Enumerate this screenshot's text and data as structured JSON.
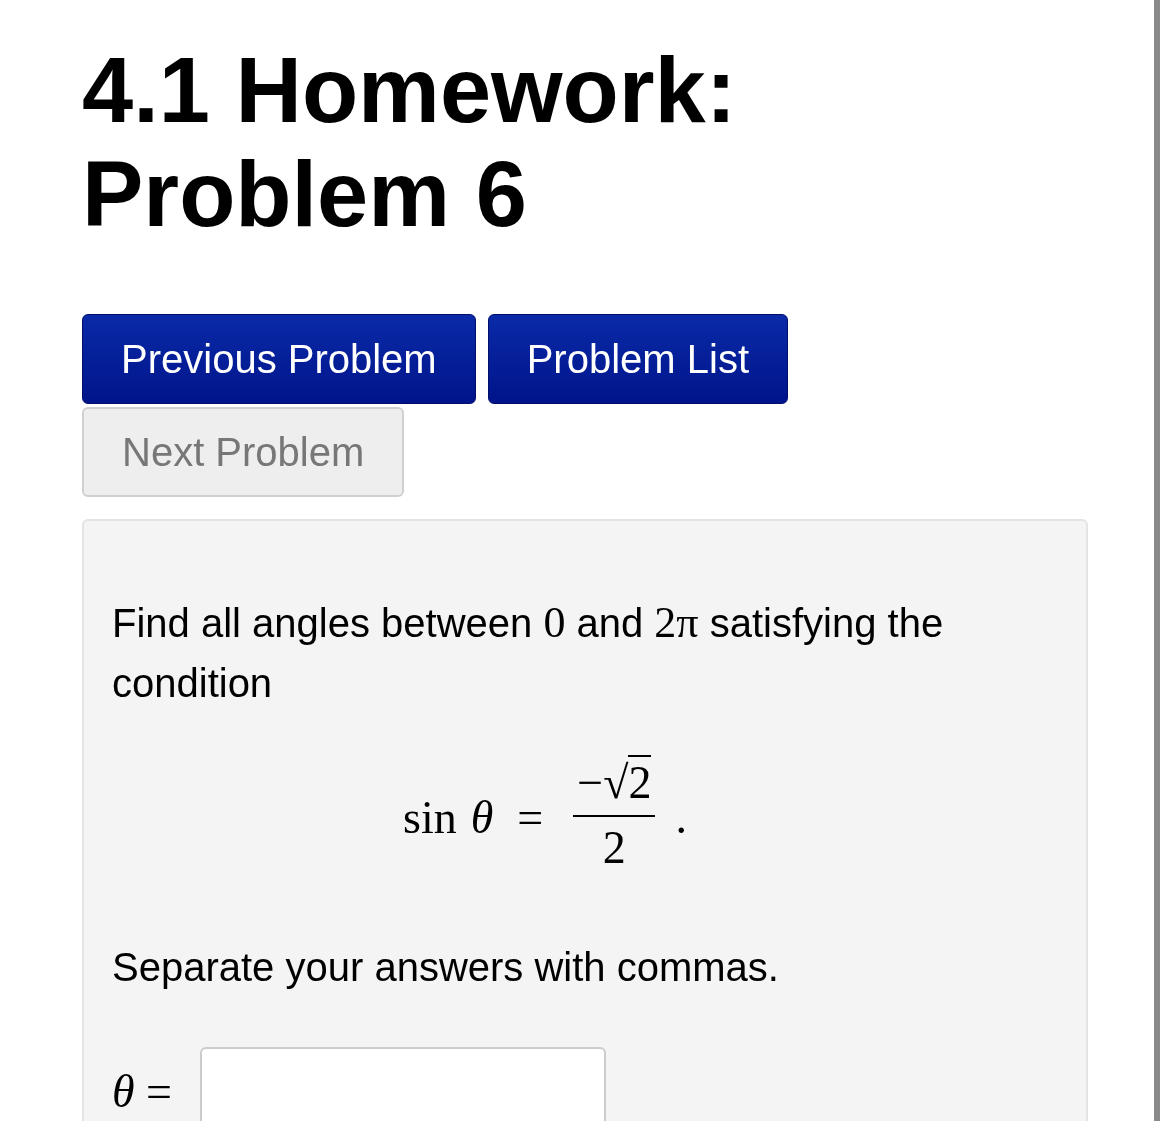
{
  "title_lines": [
    "4.1 Homework:",
    "Problem 6"
  ],
  "buttons": [
    {
      "label": "Previous Problem",
      "disabled": false
    },
    {
      "label": "Problem List",
      "disabled": false
    },
    {
      "label": "Next Problem",
      "disabled": true
    }
  ],
  "problem": {
    "intro": [
      {
        "kind": "text",
        "s": "Find all angles between "
      },
      {
        "kind": "math",
        "s": "0"
      },
      {
        "kind": "text",
        "s": " and "
      },
      {
        "kind": "math",
        "s": "2π"
      },
      {
        "kind": "text",
        "s": " satisfying the condition"
      }
    ],
    "equation": {
      "lhs_function": "sin",
      "lhs_variable": "θ",
      "relation": "=",
      "numerator_sign": "−",
      "root_sign": "√",
      "radicand": "2",
      "denominator": "2",
      "end": "."
    },
    "instruction": "Separate your answers with commas.",
    "answer": {
      "variable": "θ",
      "relation": "="
    }
  }
}
